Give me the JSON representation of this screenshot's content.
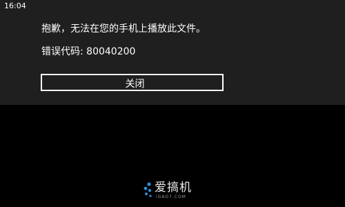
{
  "status_bar": {
    "time": "16:04"
  },
  "dialog": {
    "message": "抱歉，无法在您的手机上播放此文件。",
    "error_code_text": "错误代码: 80040200",
    "close_button_label": "关闭"
  },
  "watermark": {
    "brand": "爱搞机",
    "url": "iGAO7.COM"
  },
  "colors": {
    "dialog_background": "#1f1f1f",
    "screen_background": "#000000",
    "text": "#ffffff",
    "logo_blue": "#2f8fd8"
  }
}
